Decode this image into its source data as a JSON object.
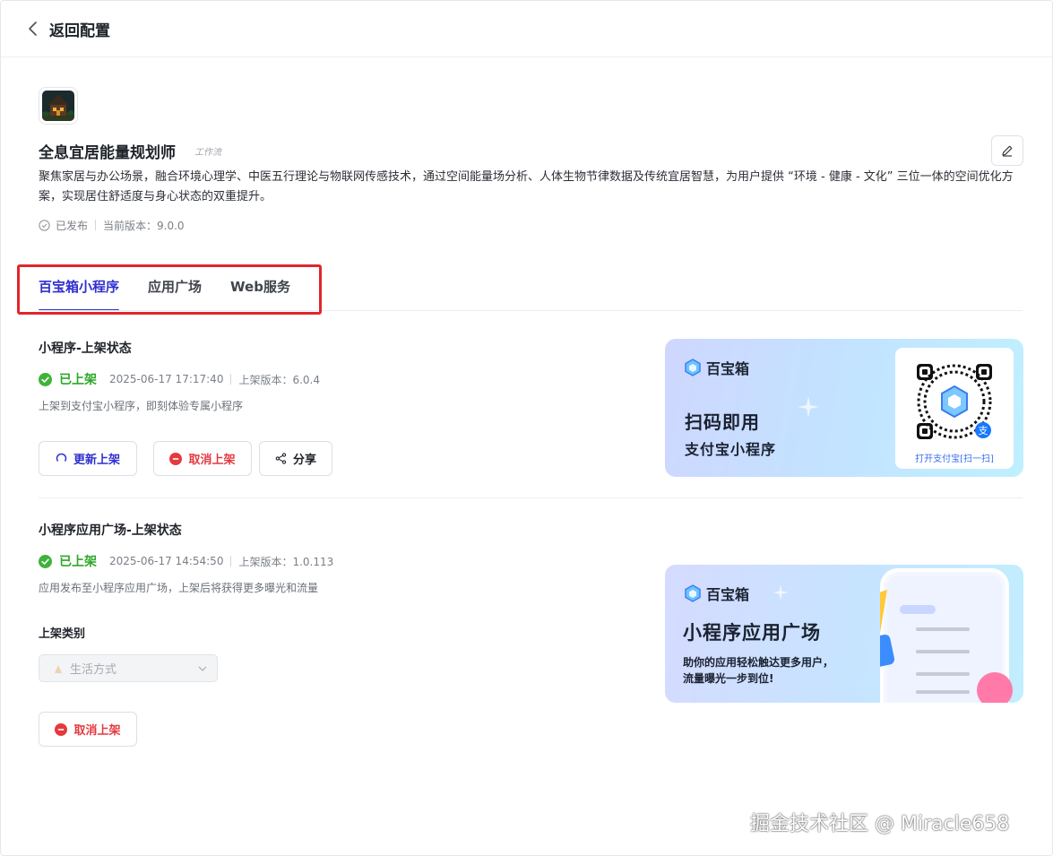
{
  "header": {
    "back_label": "返回配置"
  },
  "app": {
    "name": "全息宜居能量规划师",
    "tag": "工作流",
    "description": "聚焦家居与办公场景，融合环境心理学、中医五行理论与物联网传感技术，通过空间能量场分析、人体生物节律数据及传统宜居智慧，为用户提供 “环境 - 健康 - 文化” 三位一体的空间优化方案，实现居住舒适度与身心状态的双重提升。",
    "publish_status": "已发布",
    "version_text": "当前版本：9.0.0"
  },
  "tabs": [
    {
      "label": "百宝箱小程序",
      "active": true
    },
    {
      "label": "应用广场",
      "active": false
    },
    {
      "label": "Web服务",
      "active": false
    }
  ],
  "miniapp": {
    "title": "小程序-上架状态",
    "status": "已上架",
    "time": "2025-06-17 17:17:40",
    "version": "上架版本：6.0.4",
    "hint": "上架到支付宝小程序，即刻体验专属小程序",
    "update_button": "更新上架",
    "cancel_button": "取消上架",
    "share_button": "分享"
  },
  "banner1": {
    "brand": "百宝箱",
    "headline": "扫码即用",
    "subline": "支付宝小程序",
    "qr_caption": "打开支付宝[扫一扫]"
  },
  "plaza": {
    "title": "小程序应用广场-上架状态",
    "status": "已上架",
    "time": "2025-06-17 14:54:50",
    "version": "上架版本：1.0.113",
    "hint": "应用发布至小程序应用广场，上架后将获得更多曝光和流量",
    "category_label": "上架类别",
    "category_value": "生活方式",
    "cancel_button": "取消上架"
  },
  "banner2": {
    "brand": "百宝箱",
    "headline": "小程序应用广场",
    "sub1": "助你的应用轻松触达更多用户，",
    "sub2": "流量曝光一步到位!"
  },
  "watermark": "掘金技术社区 @ Miracle658",
  "colors": {
    "accent": "#2f2fcf",
    "success": "#2ea82a",
    "danger": "#e5393f",
    "highlight": "#e0262c"
  }
}
